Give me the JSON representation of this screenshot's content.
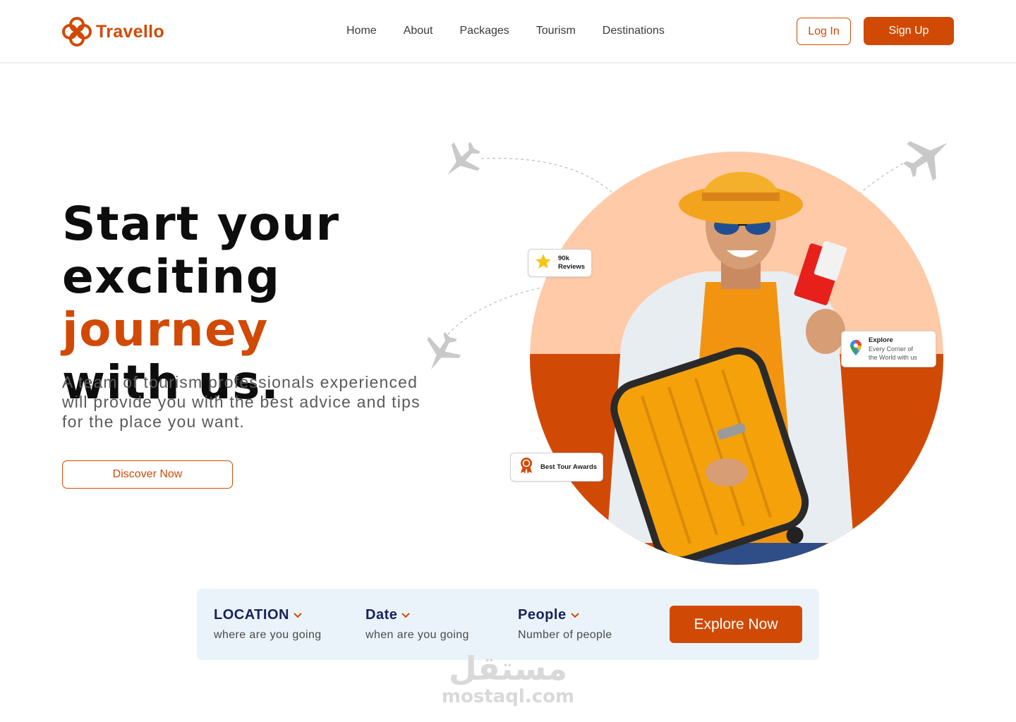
{
  "brand": {
    "name": "Travello",
    "color": "#d14a05"
  },
  "nav": {
    "items": [
      {
        "label": "Home"
      },
      {
        "label": "About"
      },
      {
        "label": "Packages"
      },
      {
        "label": "Tourism"
      },
      {
        "label": "Destinations"
      }
    ]
  },
  "auth": {
    "login_label": "Log In",
    "signup_label": "Sign Up"
  },
  "hero": {
    "headline_line1": "Start your",
    "headline_line2_prefix": "exciting ",
    "headline_accent": "journey",
    "headline_line3": "with us.",
    "subtext": "A team of tourism professionals experienced will provide you with the best advice and tips for the place you want.",
    "cta_label": "Discover Now"
  },
  "badges": {
    "reviews": {
      "count": "90k",
      "label": "Reviews",
      "icon": "star-icon"
    },
    "explore": {
      "title": "Explore",
      "line1": "Every Corner of",
      "line2": "the World with us",
      "icon": "map-pin-icon"
    },
    "awards": {
      "label": "Best Tour Awards",
      "icon": "award-ribbon-icon"
    }
  },
  "search": {
    "location": {
      "label": "LOCATION",
      "hint": "where are you going"
    },
    "date": {
      "label": "Date",
      "hint": "when are you going"
    },
    "people": {
      "label": "People",
      "hint": "Number of people"
    },
    "button_label": "Explore Now"
  },
  "colors": {
    "accent": "#d14a05",
    "circle_top": "#ffcaa8",
    "circle_bottom": "#d14a05",
    "search_bg": "#eaf3f9",
    "field_label": "#17215b"
  },
  "watermark": {
    "arabic": "مستقل",
    "latin": "mostaql.com"
  }
}
